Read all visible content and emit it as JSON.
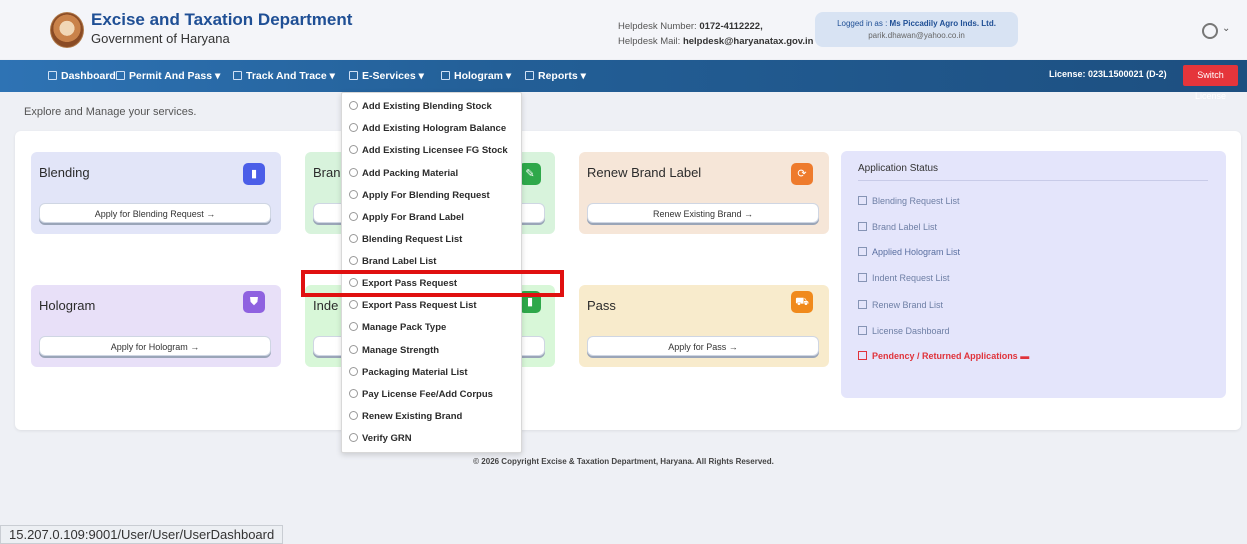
{
  "header": {
    "org_title": "Excise and Taxation Department",
    "org_sub": "Government of Haryana",
    "helpdesk_number_label": "Helpdesk Number: ",
    "helpdesk_number": "0172-4112222,",
    "helpdesk_mail_label": "Helpdesk Mail: ",
    "helpdesk_mail": "helpdesk@haryanatax.gov.in",
    "logged_in_label": "Logged in as : ",
    "logged_in_user": "Ms Piccadily Agro Inds. Ltd.",
    "logged_in_email": "parik.dhawan@yahoo.co.in"
  },
  "nav": {
    "dashboard": "Dashboard",
    "permit": "Permit And Pass",
    "track": "Track And Trace",
    "eservices": "E-Services",
    "hologram": "Hologram",
    "reports": "Reports",
    "license": "License: 023L1500021 (D-2)",
    "switch_license": "Switch License"
  },
  "explore_text": "Explore and Manage your services.",
  "cards": {
    "blending": {
      "title": "Blending",
      "button": "Apply for Blending Request →",
      "color": "#4b5ee8"
    },
    "brand": {
      "title": "Bran",
      "color": "#2ea84a"
    },
    "renew": {
      "title": "Renew Brand Label",
      "button": "Renew Existing Brand →",
      "color": "#ee7b2d"
    },
    "hologram": {
      "title": "Hologram",
      "button": "Apply for Hologram →",
      "color": "#8f62e0"
    },
    "indent": {
      "title": "Inde",
      "color": "#2ea84a"
    },
    "pass": {
      "title": "Pass",
      "button": "Apply for Pass →",
      "color": "#f08a1c"
    }
  },
  "application_status": {
    "title": "Application Status",
    "items": [
      "Blending Request List",
      "Brand Label List",
      "Applied Hologram List",
      "Indent Request List",
      "Renew Brand List",
      "License Dashboard",
      "Pendency / Returned Applications"
    ]
  },
  "dropdown": {
    "items": [
      "Add Existing Blending Stock",
      "Add Existing Hologram Balance",
      "Add Existing Licensee FG Stock",
      "Add Packing Material",
      "Apply For Blending Request",
      "Apply For Brand Label",
      "Blending Request List",
      "Brand Label List",
      "Export Pass Request",
      "Export Pass Request List",
      "Manage Pack Type",
      "Manage Strength",
      "Packaging Material List",
      "Pay License Fee/Add Corpus",
      "Renew Existing Brand",
      "Verify GRN"
    ],
    "highlighted": "Export Pass Request"
  },
  "footer": "© 2026 Copyright Excise & Taxation Department, Haryana. All Rights Reserved.",
  "status_url": "15.207.0.109:9001/User/User/UserDashboard"
}
